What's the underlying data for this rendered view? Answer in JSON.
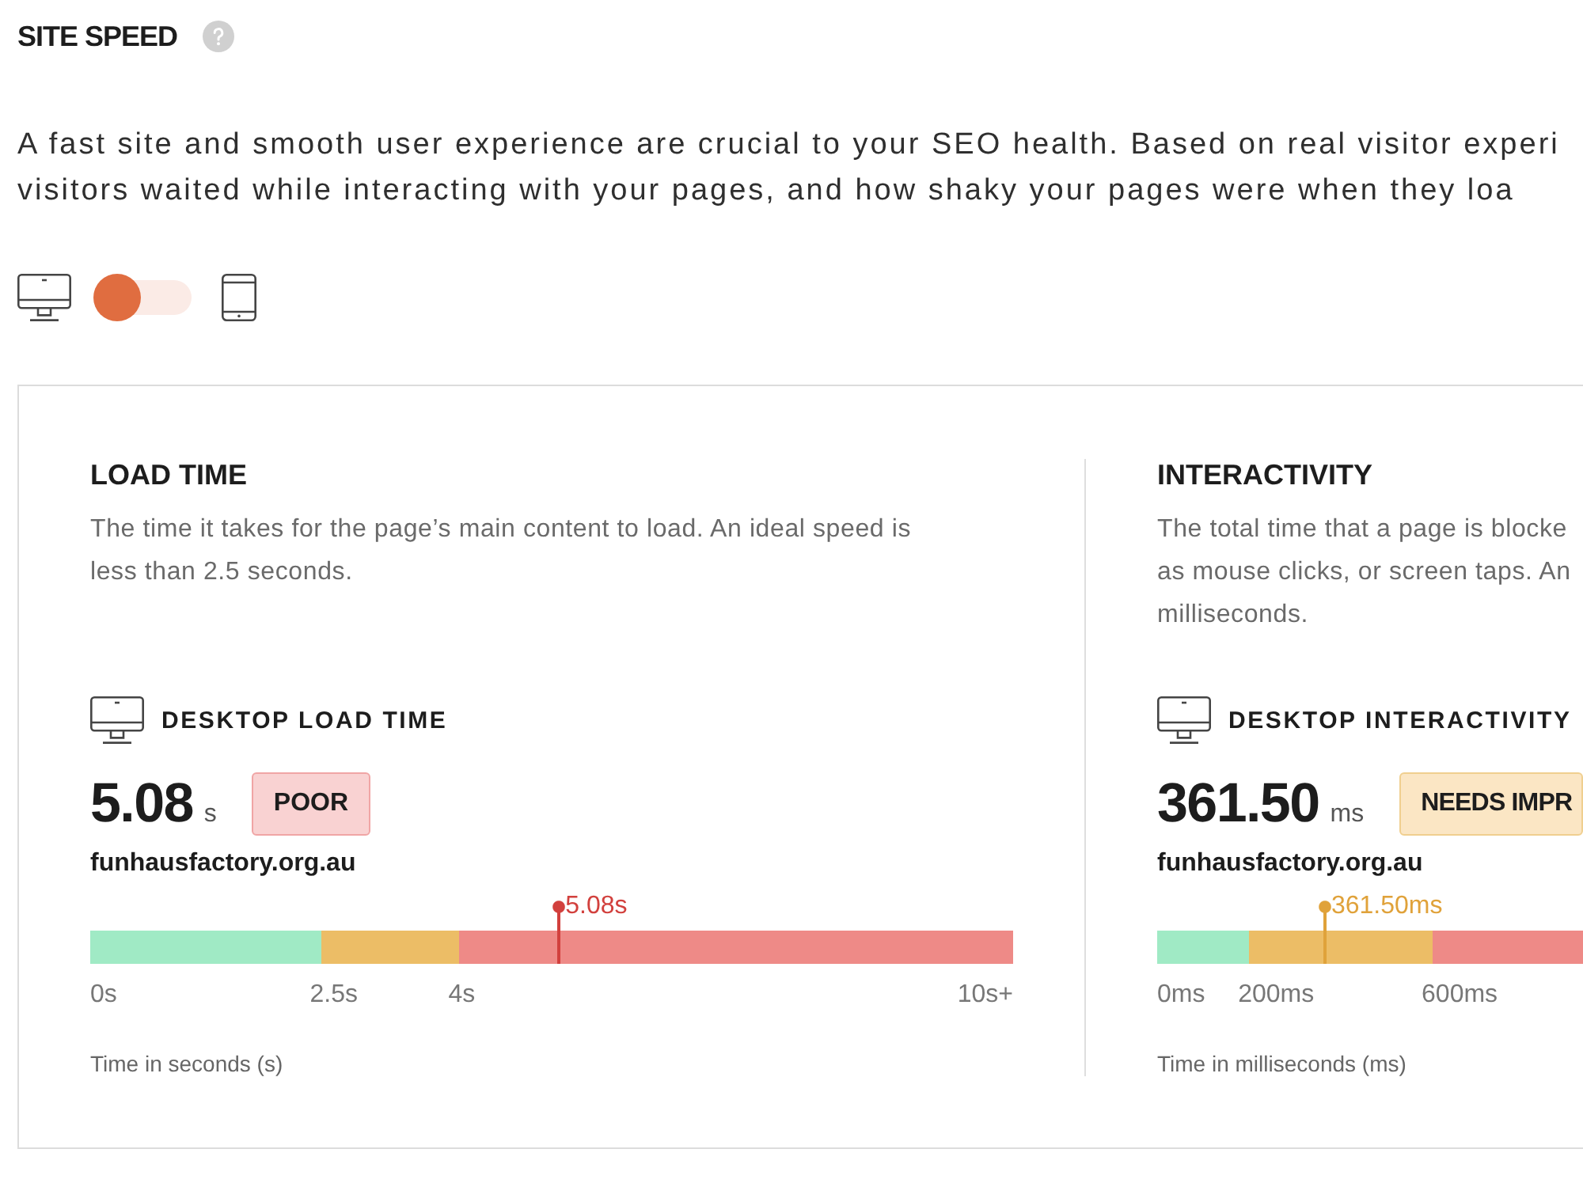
{
  "title": "SITE SPEED",
  "description_lines": [
    "A fast site and smooth user experience are crucial to your SEO health. Based on real visitor experi",
    "visitors waited while interacting with your pages, and how shaky your pages were when they loa"
  ],
  "device_toggle": {
    "on": false
  },
  "panels": [
    {
      "heading": "LOAD TIME",
      "description_lines": [
        "The time it takes for the page’s main content to load. An ideal speed is",
        "less than 2.5 seconds."
      ],
      "metric_title": "DESKTOP LOAD TIME",
      "value": "5.08",
      "unit": "s",
      "rating": {
        "kind": "poor",
        "label": "POOR"
      },
      "site": "funhausfactory.org.au",
      "gauge": {
        "marker": {
          "level": 0.508,
          "label": "5.08s"
        },
        "bands": [
          {
            "color": "#a0eac5",
            "level": 0.25
          },
          {
            "color": "#ecbd66",
            "level": 0.4
          },
          {
            "color": "#ee8a87"
          }
        ],
        "ticks": [
          "0s",
          "2.5s",
          "4s",
          "10s+"
        ]
      },
      "axis_caption": "Time in seconds (s)"
    },
    {
      "heading": "INTERACTIVITY",
      "description_lines": [
        "The total time that a page is blocke",
        "as mouse clicks, or screen taps. An",
        "milliseconds."
      ],
      "metric_title": "DESKTOP INTERACTIVITY",
      "value": "361.50",
      "unit": "ms",
      "rating": {
        "kind": "needs-improvement",
        "label": "NEEDS IMPR"
      },
      "site": "funhausfactory.org.au",
      "gauge": {
        "marker": {
          "level": 0.394,
          "label": "361.50ms"
        },
        "bands": [
          {
            "color": "#a0eac5",
            "level": 0.216
          },
          {
            "color": "#ecbd66",
            "level": 0.647
          },
          {
            "color": "#ee8a87"
          }
        ],
        "ticks": [
          "0ms",
          "200ms",
          "600ms"
        ]
      },
      "axis_caption": "Time in milliseconds (ms)"
    }
  ]
}
